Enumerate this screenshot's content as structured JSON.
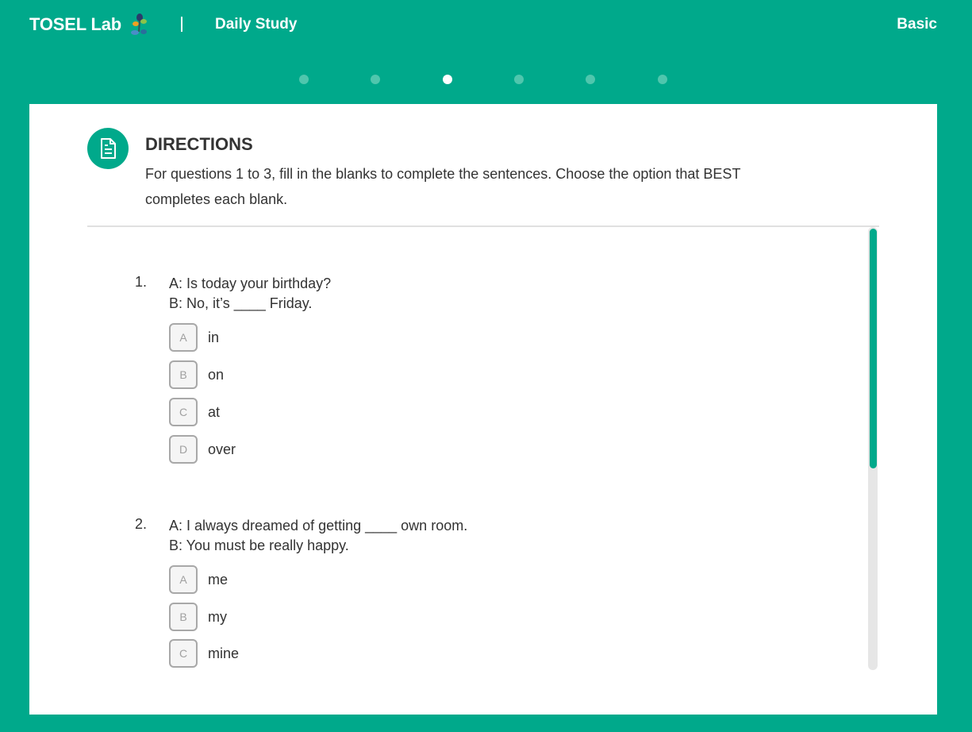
{
  "header": {
    "brand": "TOSEL Lab",
    "section": "Daily Study",
    "level": "Basic"
  },
  "progress": {
    "total": 6,
    "current": 3
  },
  "directions": {
    "title": "DIRECTIONS",
    "text": "For questions 1 to 3, fill in the blanks to complete the sentences. Choose the option that BEST completes each blank."
  },
  "questions": [
    {
      "number": "1.",
      "text": "A: Is today your birthday?\nB: No, it’s ____ Friday.",
      "options": [
        {
          "key": "A",
          "label": "in"
        },
        {
          "key": "B",
          "label": "on"
        },
        {
          "key": "C",
          "label": "at"
        },
        {
          "key": "D",
          "label": "over"
        }
      ]
    },
    {
      "number": "2.",
      "text": "A: I always dreamed of getting ____ own room.\nB: You must be really happy.",
      "options": [
        {
          "key": "A",
          "label": "me"
        },
        {
          "key": "B",
          "label": "my"
        },
        {
          "key": "C",
          "label": "mine"
        }
      ]
    }
  ],
  "colors": {
    "brand": "#00a98b",
    "dot_inactive": "#4fc6ad",
    "dot_active": "#ffffff"
  },
  "icons": {
    "directions": "document-icon",
    "logo": "sprout-logo-icon"
  }
}
